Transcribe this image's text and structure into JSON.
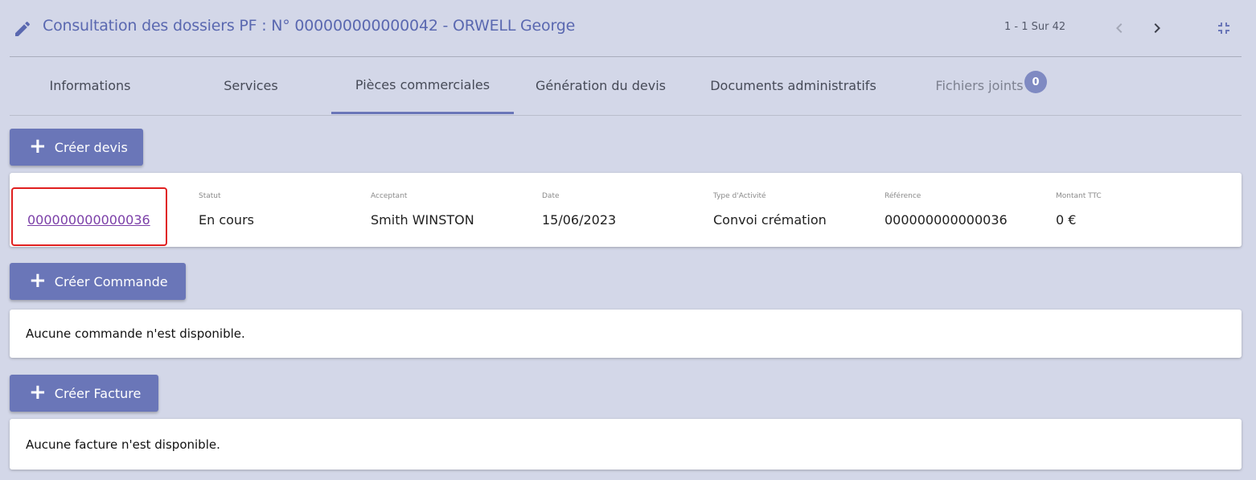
{
  "header": {
    "title": "Consultation des dossiers PF : N° 000000000000042 - ORWELL George",
    "pager": "1 - 1 Sur 42",
    "icons": {
      "edit": "pencil-icon",
      "prev": "chevron-left-icon",
      "next": "chevron-right-icon",
      "collapse": "fullscreen-exit-icon"
    }
  },
  "tabs": [
    {
      "label": "Informations"
    },
    {
      "label": "Services"
    },
    {
      "label": "Pièces commerciales"
    },
    {
      "label": "Génération du devis"
    },
    {
      "label": "Documents administratifs"
    },
    {
      "label": "Fichiers joints",
      "badge": "0"
    }
  ],
  "devis": {
    "button_label": "Créer devis",
    "labels": {
      "statut": "Statut",
      "acceptant": "Acceptant",
      "date": "Date",
      "type": "Type d'Activité",
      "reference": "Référence",
      "montant": "Montant TTC"
    },
    "row": {
      "numero": "000000000000036",
      "statut": "En cours",
      "acceptant": "Smith WINSTON",
      "date": "15/06/2023",
      "type": "Convoi crémation",
      "reference": "000000000000036",
      "montant": "0 €"
    }
  },
  "commande": {
    "button_label": "Créer Commande",
    "empty_text": "Aucune commande n'est disponible."
  },
  "facture": {
    "button_label": "Créer Facture",
    "empty_text": "Aucune facture n'est disponible."
  },
  "colors": {
    "background": "#d3d7e8",
    "accent": "#6a76b8",
    "title": "#5a68b0",
    "link": "#7b3fa8",
    "highlight": "#e02020"
  }
}
